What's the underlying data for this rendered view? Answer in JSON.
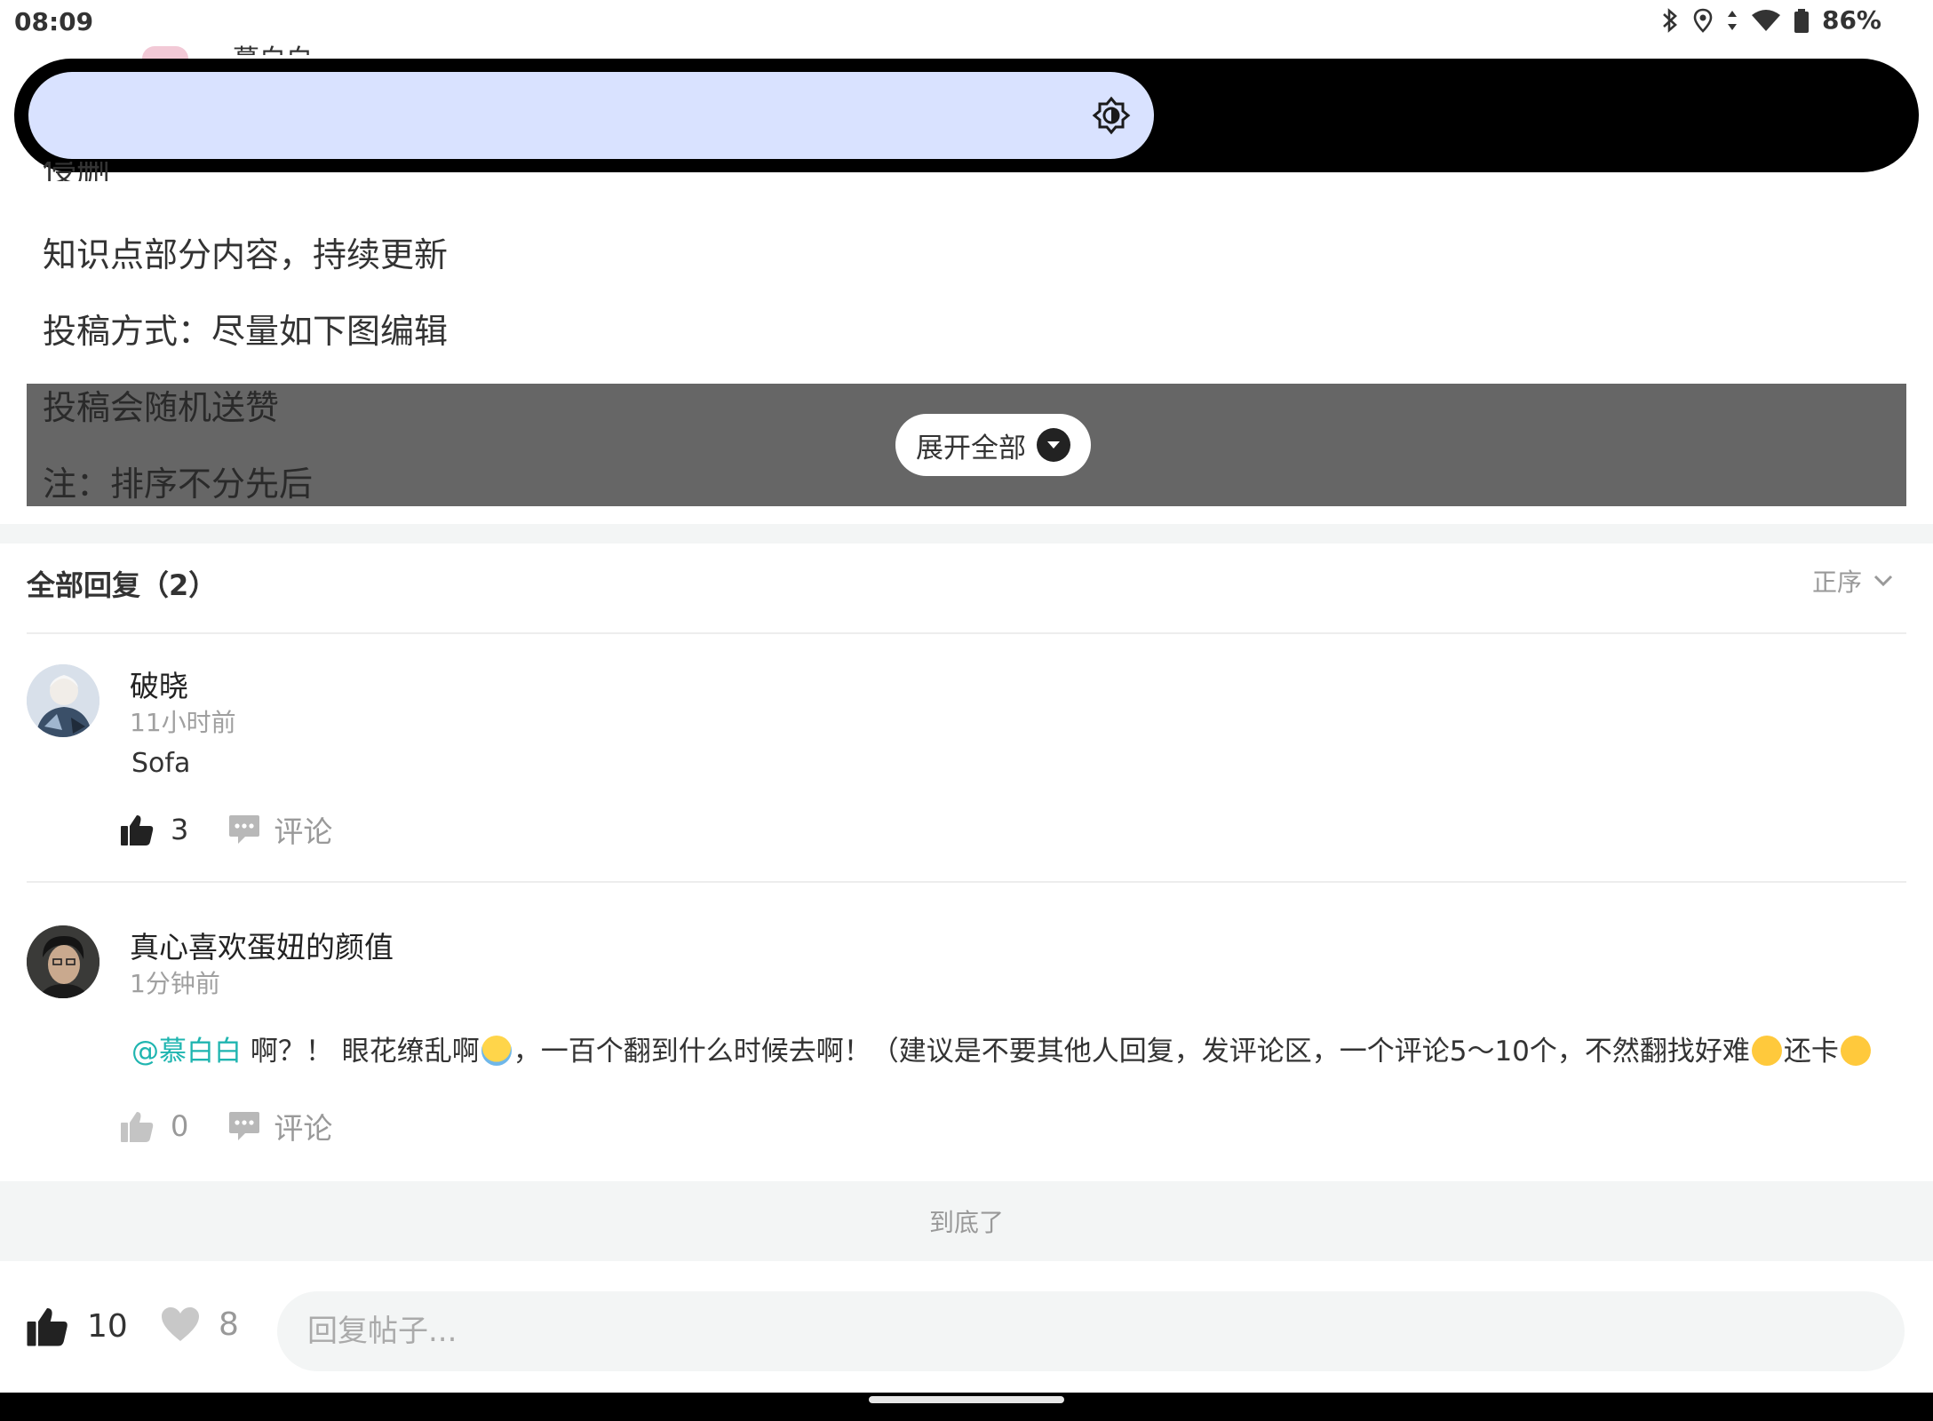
{
  "status_bar": {
    "time": "08:09",
    "battery": "86%",
    "icons": [
      "bluetooth-icon",
      "location-icon",
      "data-arrows-icon",
      "wifi-icon",
      "battery-icon"
    ]
  },
  "brightness": {
    "level": 0.6,
    "icon": "brightness-icon",
    "colors": {
      "panel": "#000000",
      "slider": "#d9e2ff"
    }
  },
  "post": {
    "partial_author": "慕白白",
    "partial_line": "侵删",
    "lines": [
      "知识点部分内容，持续更新",
      "投稿方式：尽量如下图编辑"
    ],
    "collapsed_lines": [
      "投稿会随机送赞",
      "注：排序不分先后"
    ],
    "expand_label": "展开全部"
  },
  "replies": {
    "title": "全部回复（2）",
    "sort_label": "正序",
    "items": [
      {
        "name": "破晓",
        "time": "11小时前",
        "text": "Sofa",
        "likes": "3",
        "comment_label": "评论"
      },
      {
        "name": "真心喜欢蛋妞的颜值",
        "time": "1分钟前",
        "mention": "@慕白白",
        "text_a": " 啊？！ 眼花缭乱啊",
        "text_b": "，一百个翻到什么时候去啊！（建议是不要其他人回复，发评论区，一个评论5～10个，不然翻找好难",
        "text_c": "还卡",
        "likes": "0",
        "comment_label": "评论"
      }
    ]
  },
  "end_label": "到底了",
  "bottom_bar": {
    "likes": "10",
    "favorites": "8",
    "reply_placeholder": "回复帖子..."
  },
  "colors": {
    "accent_mention": "#1fb5b0",
    "collapse_overlay": "#666666",
    "section_gap": "#f3f5f5"
  }
}
